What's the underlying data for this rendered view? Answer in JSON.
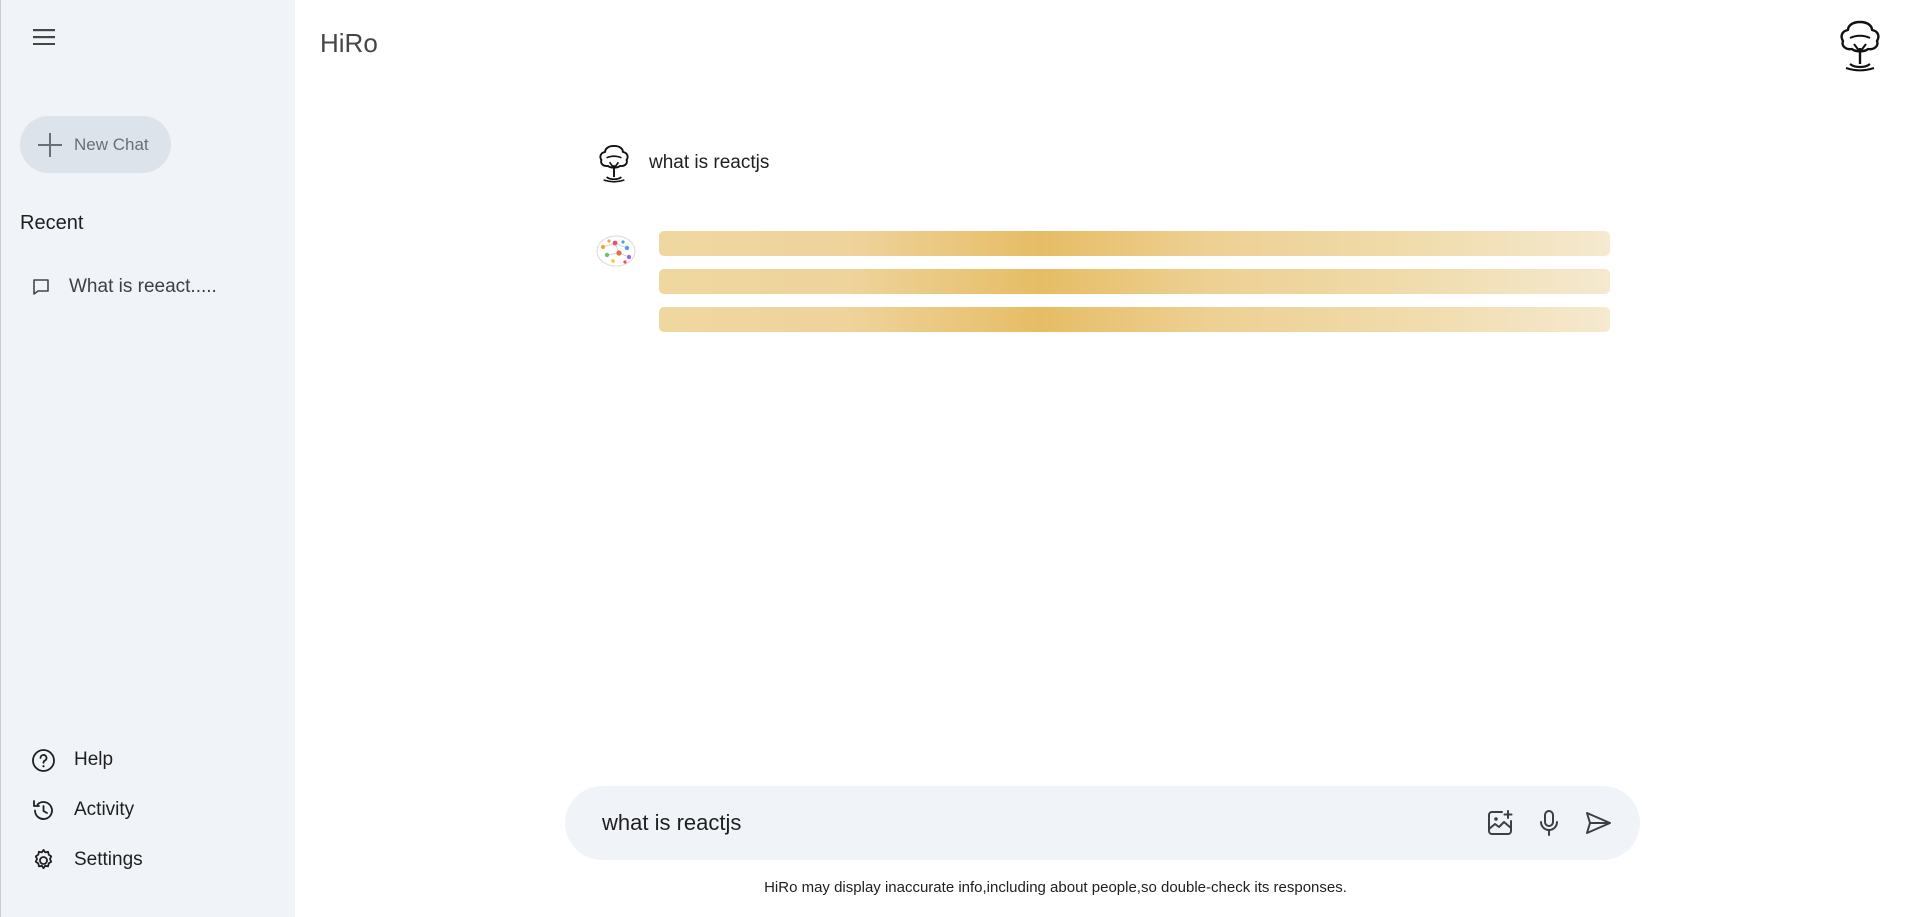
{
  "sidebar": {
    "new_chat_label": "New Chat",
    "recent_title": "Recent",
    "recent_items": [
      {
        "label": "What is reeact....."
      }
    ],
    "links": {
      "help": "Help",
      "activity": "Activity",
      "settings": "Settings"
    }
  },
  "header": {
    "app_title": "HiRo"
  },
  "conversation": {
    "user_message": "what is reactjs",
    "response_state": "loading"
  },
  "composer": {
    "value": "what is reactjs"
  },
  "footer": {
    "disclaimer": "HiRo may display inaccurate info,including about people,so double-check its responses."
  },
  "icons": [
    "menu-icon",
    "plus-icon",
    "chat-bubble-icon",
    "help-icon",
    "history-icon",
    "gear-icon",
    "tree-avatar-icon",
    "brain-icon",
    "image-add-icon",
    "mic-icon",
    "send-icon"
  ],
  "colors": {
    "sidebar_bg": "#f0f4f9",
    "new_chat_bg": "#dde3ea",
    "loader_gold": "#e6bd65",
    "composer_bg": "#f0f4f9"
  }
}
